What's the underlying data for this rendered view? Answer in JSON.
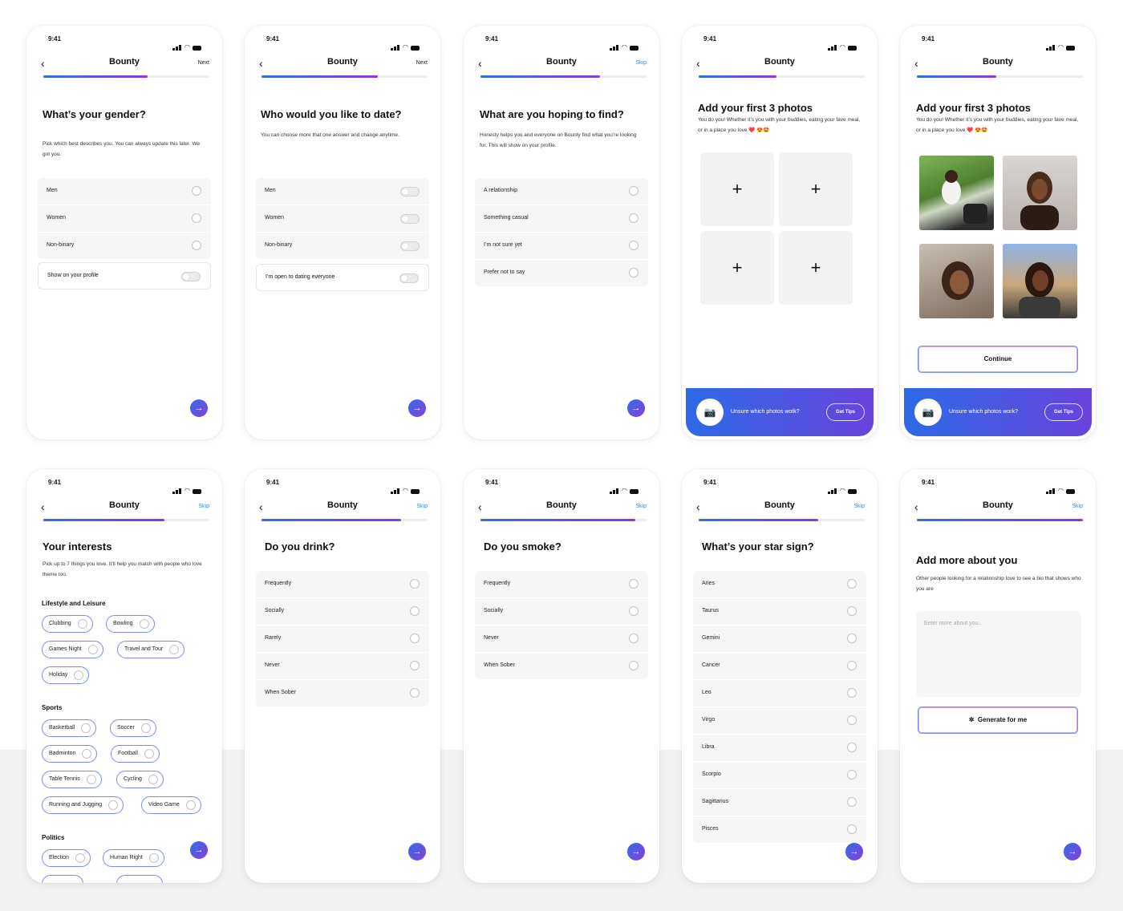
{
  "status": {
    "time": "9:41"
  },
  "app": {
    "title": "Bounty",
    "next": "Next",
    "skip": "Skip"
  },
  "screens": {
    "gender": {
      "title": "What’s your gender?",
      "desc": "Pick which best describes you. You can always update this later. We got you.",
      "options": [
        "Men",
        "Women",
        "Non-binary"
      ],
      "toggle_label": "Show on your profile",
      "progress": 0.63
    },
    "date": {
      "title": "Who would you like to date?",
      "desc": "You can choose more that one answer and change anytime.",
      "options": [
        "Men",
        "Women",
        "Non-binary"
      ],
      "toggle_label": "I’m open to dating everyone",
      "progress": 0.7
    },
    "hoping": {
      "title": "What are you hoping to find?",
      "desc": "Honesty helps you and everyone on Bounty find what you’re looking for. This will show on your profile.",
      "options": [
        "A relationship",
        "Something casual",
        "I’m not sure yet",
        "Prefer not to say"
      ],
      "progress": 0.72
    },
    "photos_empty": {
      "title": "Add your first 3 photos",
      "desc": "You do you! Whether it’s you with your buddies, eating your fave meal, or in a place you love ❤️ 😍🤩",
      "slot_symbol": "+",
      "banner_text": "Unsure which photos wotk?",
      "tips_button": "Get Tips",
      "progress": 0.47
    },
    "photos_filled": {
      "title": "Add your first 3 photos",
      "desc": "You do you! Whether it’s you with your buddies, eating your fave meal, or in a place you love ❤️ 😍🤩",
      "continue_button": "Continue",
      "banner_text": "Unsure which photos work?",
      "tips_button": "Get Tips",
      "progress": 0.48
    },
    "interests": {
      "title": "Your interests",
      "desc": "Pick up to 7 things you love. It’ll help you match with people who love theme too.",
      "sections": [
        {
          "name": "Lifestyle and Leisure",
          "chips": [
            "Clubbing",
            "Bowling",
            "Games Night",
            "Travel and Tour",
            "Holiday"
          ]
        },
        {
          "name": "Sports",
          "chips": [
            "Basketball",
            "Soccer",
            "Badminton",
            "Football",
            "Table Tennis",
            "Cycling",
            "Running and Jugging",
            "Video Game"
          ]
        },
        {
          "name": "Politics",
          "chips": [
            "Election",
            "Human Right"
          ]
        }
      ],
      "progress": 0.73
    },
    "drink": {
      "title": "Do you drink?",
      "options": [
        "Frequently",
        "Socially",
        "Rarely",
        "Never",
        "When Sober"
      ],
      "progress": 0.84
    },
    "smoke": {
      "title": "Do you smoke?",
      "options": [
        "Frequently",
        "Socially",
        "Never",
        "When Sober"
      ],
      "progress": 0.93
    },
    "star": {
      "title": "What’s your star sign?",
      "options": [
        "Aries",
        "Taurus",
        "Gemini",
        "Cancer",
        "Leo",
        "Virgo",
        "Libra",
        "Scorpio",
        "Sagittarius",
        "Pisces"
      ],
      "progress": 0.72
    },
    "bio": {
      "title": "Add more about you",
      "desc": "Other people looking for a relationship love to see a bio that shows who you are",
      "placeholder": "Enter more about you..",
      "generate_button": "Generate for me",
      "progress": 1.0
    }
  },
  "colors": {
    "accent_start": "#2e6ee6",
    "accent_end": "#8b3ddb",
    "link": "#2f8cf0"
  }
}
